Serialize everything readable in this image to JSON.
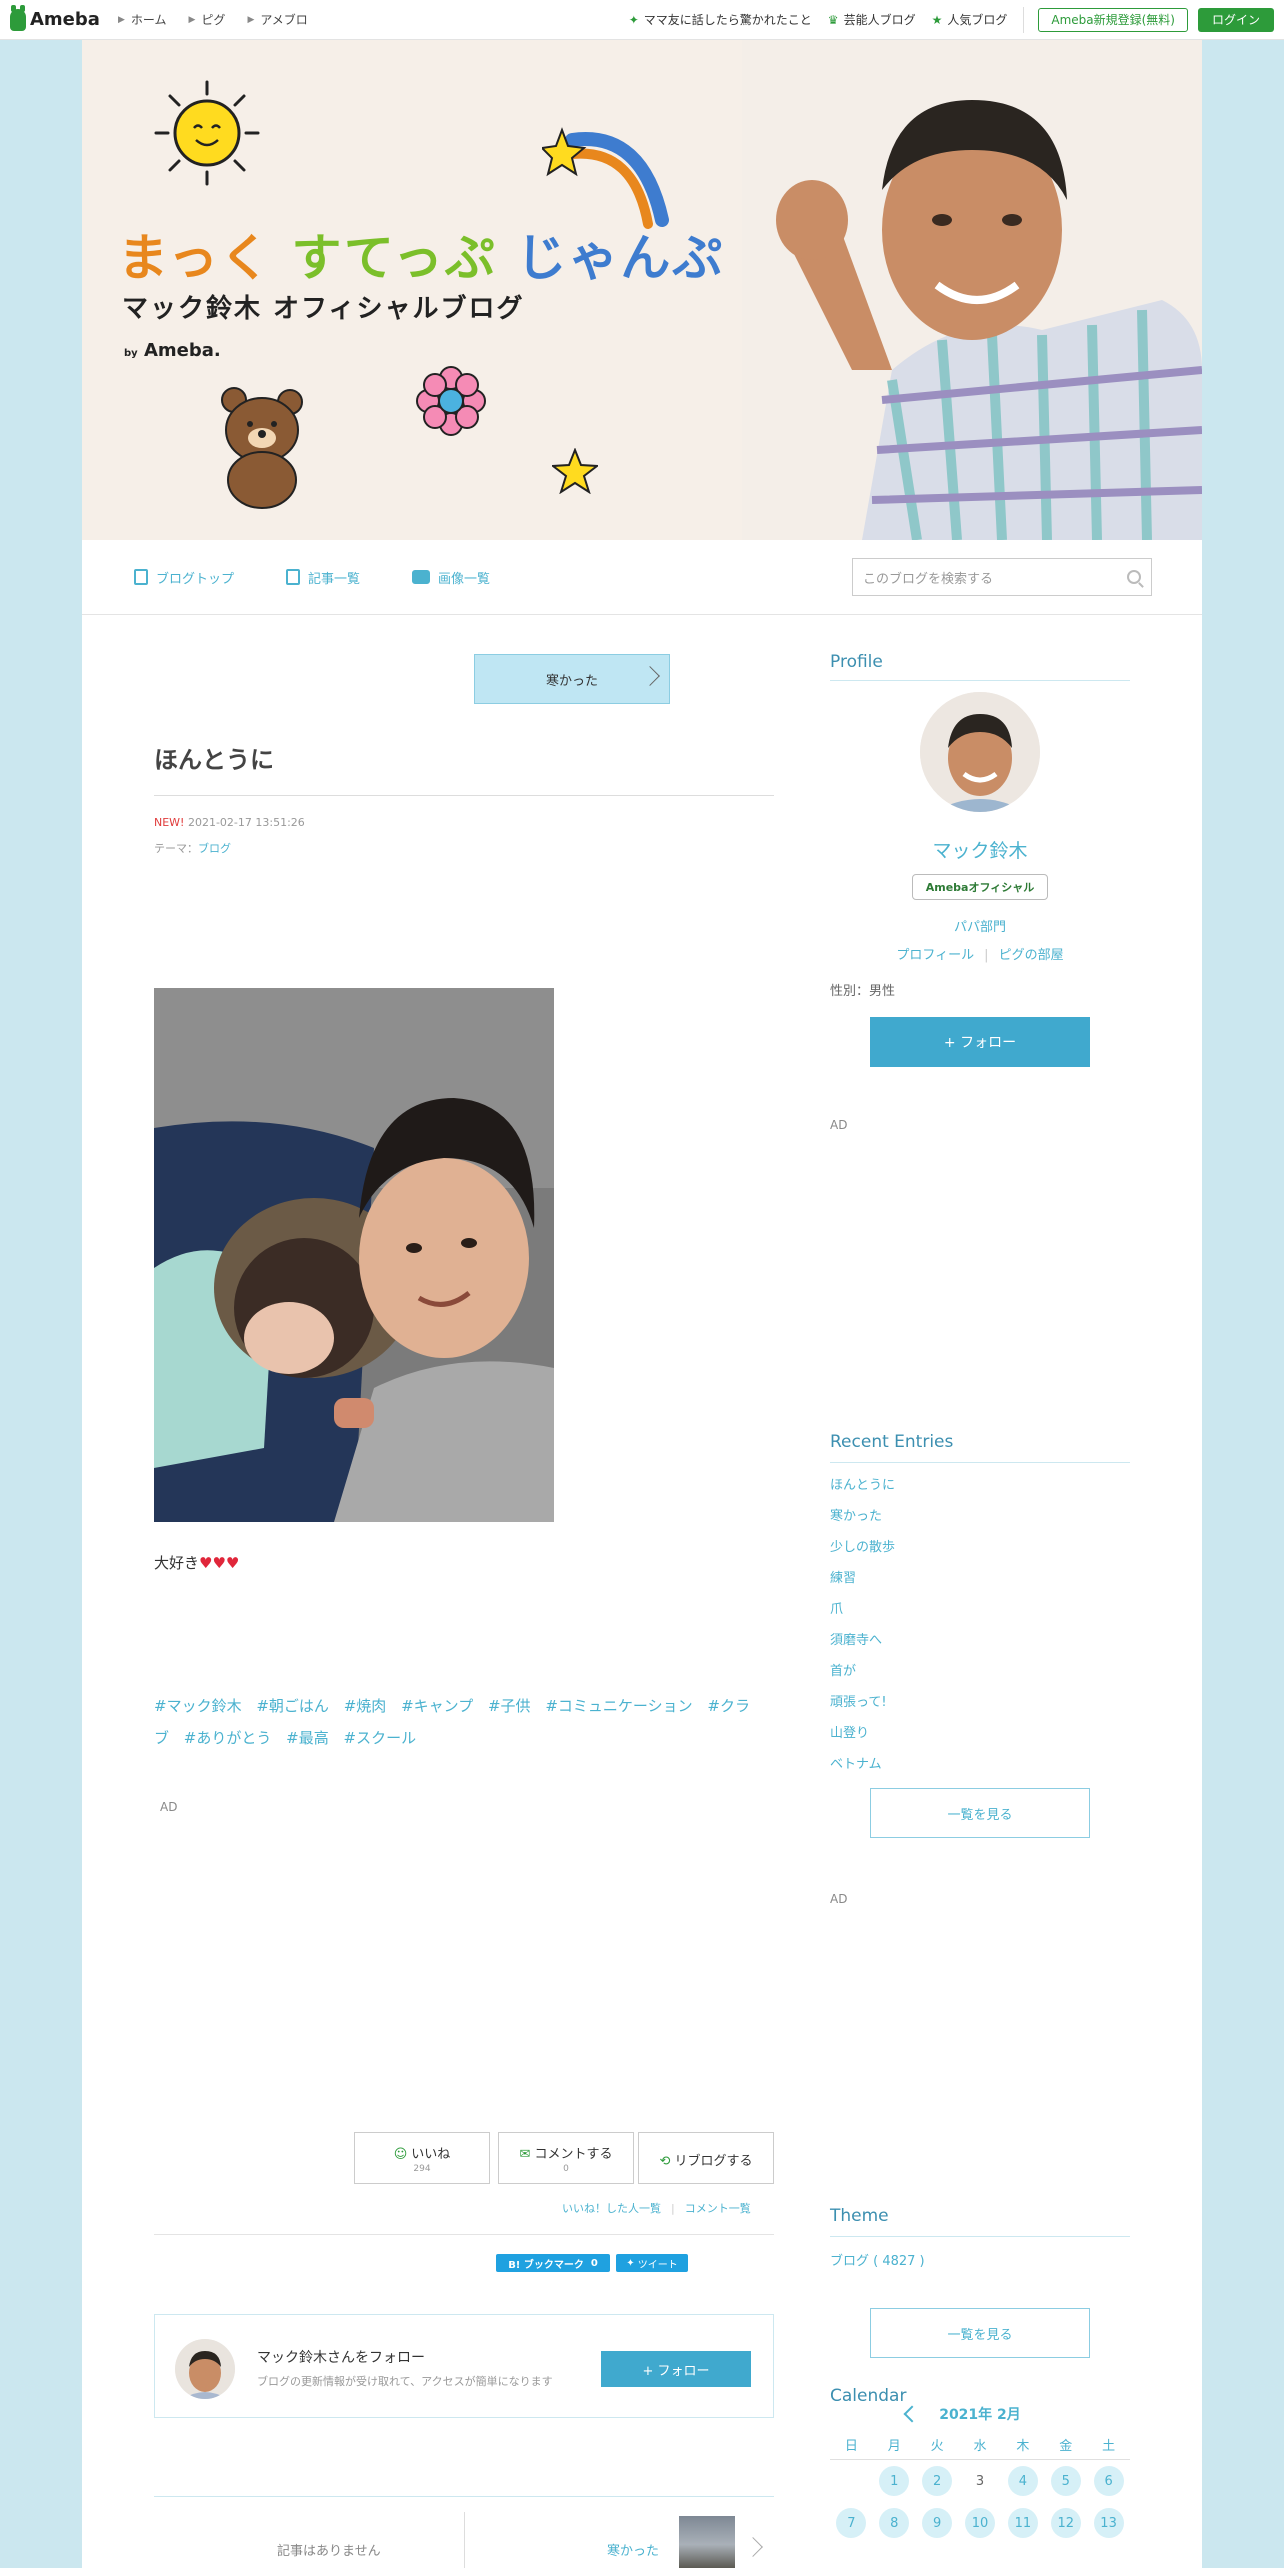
{
  "topbar": {
    "logo": "Ameba",
    "nav": [
      "ホーム",
      "ピグ",
      "アメブロ"
    ],
    "links": [
      {
        "icon": "sparkle-icon",
        "label": "ママ友に話したら驚かれたこと"
      },
      {
        "icon": "crown-icon",
        "label": "芸能人ブログ"
      },
      {
        "icon": "star-icon",
        "label": "人気ブログ"
      }
    ],
    "register": "Ameba新規登録(無料)",
    "login": "ログイン"
  },
  "banner": {
    "title_part1": "まっく",
    "title_part2": "すてっぷ",
    "title_part3": "じゃんぷ",
    "subtitle": "マック鈴木 オフィシャルブログ",
    "by": "by",
    "brand": "Ameba."
  },
  "blognav": {
    "items": [
      {
        "icon": "document-icon",
        "label": "ブログトップ"
      },
      {
        "icon": "copy-icon",
        "label": "記事一覧"
      },
      {
        "icon": "camera-icon",
        "label": "画像一覧"
      }
    ],
    "search_placeholder": "このブログを検索する"
  },
  "post": {
    "prev_label": "寒かった",
    "title": "ほんとうに",
    "new_badge": "NEW!",
    "date": "2021-02-17 13:51:26",
    "theme_prefix": "テーマ：",
    "theme": "ブログ",
    "body_text": "大好き",
    "hearts": "♥♥♥",
    "tags": [
      "#マック鈴木",
      "#朝ごはん",
      "#焼肉",
      "#キャンプ",
      "#子供",
      "#コミュニケーション",
      "#クラブ",
      "#ありがとう",
      "#最高",
      "#スクール"
    ],
    "ad": "AD"
  },
  "actions": {
    "like": "いいね",
    "like_count": "294",
    "comment": "コメントする",
    "comment_count": "0",
    "reblog": "リブログする",
    "liked_list": "いいね！した人一覧",
    "comment_list": "コメント一覧",
    "hatena": "B! ブックマーク",
    "hatena_count": "0",
    "tweet": "ツイート"
  },
  "follow_box": {
    "name": "マック鈴木さんをフォロー",
    "desc": "ブログの更新情報が受け取れて、アクセスが簡単になります",
    "button": "+ フォロー"
  },
  "pager": {
    "next": "記事はありません",
    "prev": "寒かった"
  },
  "sidebar": {
    "profile_heading": "Profile",
    "name": "マック鈴木",
    "badge": "Amebaオフィシャル",
    "category": "パパ部門",
    "link1": "プロフィール",
    "link2": "ピグの部屋",
    "gender": "性別：男性",
    "follow": "+ フォロー",
    "ad1": "AD",
    "recent_heading": "Recent Entries",
    "entries": [
      "ほんとうに",
      "寒かった",
      "少しの散歩",
      "練習",
      "爪",
      "須磨寺へ",
      "首が",
      "頑張って!",
      "山登り",
      "ベトナム"
    ],
    "see_all": "一覧を見る",
    "ad2": "AD",
    "theme_heading": "Theme",
    "theme_item": "ブログ ( 4827 )",
    "see_all2": "一覧を見る",
    "calendar_heading": "Calendar",
    "calendar_month": "2021年 2月",
    "dow": [
      "日",
      "月",
      "火",
      "水",
      "木",
      "金",
      "土"
    ],
    "week1": [
      "",
      "1",
      "2",
      "3",
      "4",
      "5",
      "6"
    ],
    "week2": [
      "7",
      "8",
      "9",
      "10",
      "11",
      "12",
      "13"
    ]
  },
  "colors": {
    "accent": "#4bb2cf",
    "ameba_green": "#2d9b3a",
    "page_bg": "#cbe7ef",
    "follow_button": "#40a9ce"
  }
}
